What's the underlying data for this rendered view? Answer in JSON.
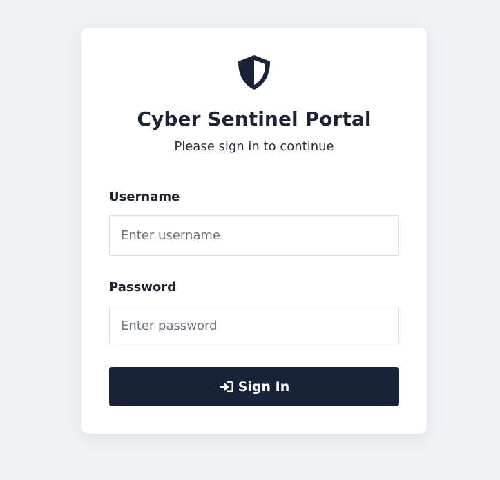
{
  "brand": {
    "logo_icon": "shield-half-icon",
    "title": "Cyber Sentinel Portal",
    "subtitle": "Please sign in to continue"
  },
  "form": {
    "username": {
      "label": "Username",
      "placeholder": "Enter username",
      "value": ""
    },
    "password": {
      "label": "Password",
      "placeholder": "Enter password",
      "value": ""
    },
    "submit": {
      "label": "Sign In",
      "icon": "sign-in-icon"
    }
  },
  "colors": {
    "background": "#eff1f5",
    "card": "#ffffff",
    "primary": "#18233a",
    "text": "#1c2433"
  }
}
